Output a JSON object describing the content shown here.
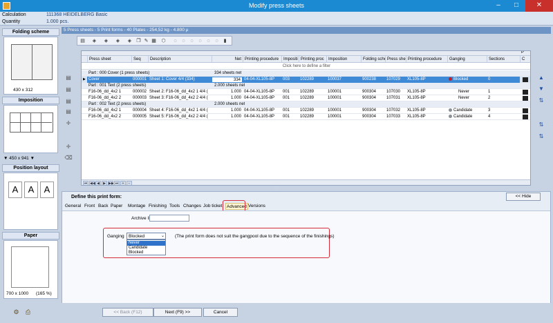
{
  "window": {
    "title": "Modify press sheets",
    "minimize": "–",
    "maximize": "□",
    "close": "✕"
  },
  "header": {
    "calculation_label": "Calculation",
    "calculation_value": "111368 HEIDELBERG Basic",
    "quantity_label": "Quantity",
    "quantity_value": "1.000 pcs."
  },
  "left_panel": {
    "folding": {
      "title": "Folding scheme",
      "size": "430 x 312"
    },
    "imposition": {
      "title": "Imposition",
      "size": "450 x 941"
    },
    "position": {
      "title": "Position layout",
      "cells": [
        "A",
        "A",
        "A"
      ]
    },
    "paper": {
      "title": "Paper",
      "size": "700 x 1000",
      "percent": "(165 %)"
    }
  },
  "main": {
    "summary": "5 Press sheets - 5 Print forms - 40 Plates - 254,52 kg - 4.800 µ"
  },
  "grid": {
    "top_header_mark": "P",
    "columns": [
      "Press sheet",
      "Seq",
      "Description",
      "Net",
      "Printing procedure",
      "Impositi",
      "Printing proc",
      "Imposition",
      "Folding sche",
      "Press she",
      "Printing procedure",
      "Ganging",
      "Sections",
      "C"
    ],
    "filter_text": "Click here to define a filter",
    "groups": [
      {
        "label": "Part : 000 Cover (1 press sheets)",
        "total": "334 sheets net",
        "rows": [
          {
            "sheet": "Cover",
            "seq": "000001",
            "desc": "Sheet 1: Cover 4/4 (334)",
            "net": "334",
            "proc": "04-04-XL105-8P",
            "imp": "003",
            "pproc": "102289",
            "imposition": "100037",
            "fold": "900238",
            "press": "107029",
            "proc2": "XL105-8P",
            "ganging": "Blocked",
            "sections": "0"
          }
        ]
      },
      {
        "label": "Part : 001 Text (2 press sheets)",
        "total": "2.000 sheets net",
        "rows": [
          {
            "sheet": "F16-06_dd_4x2 1",
            "seq": "000002",
            "desc": "Sheet 2: F16-06_dd_4x2 1 4/4 (",
            "net": "1.000",
            "proc": "04-04-XL105-8P",
            "imp": "001",
            "pproc": "102289",
            "imposition": "100001",
            "fold": "900304",
            "press": "107030",
            "proc2": "XL105-8P",
            "ganging": "Never",
            "sections": "1"
          },
          {
            "sheet": "F16-06_dd_4x2 2",
            "seq": "000003",
            "desc": "Sheet 3: F16-06_dd_4x2 2 4/4 (",
            "net": "1.000",
            "proc": "04-04-XL105-8P",
            "imp": "001",
            "pproc": "102289",
            "imposition": "100001",
            "fold": "900304",
            "press": "107031",
            "proc2": "XL105-8P",
            "ganging": "Never",
            "sections": "2"
          }
        ]
      },
      {
        "label": "Part : 002 Text (2 press sheets)",
        "total": "2.000 sheets net",
        "rows": [
          {
            "sheet": "F16-06_dd_4x2 1",
            "seq": "000004",
            "desc": "Sheet 4: F16-06_dd_4x2 1 4/4 (",
            "net": "1.000",
            "proc": "04-04-XL105-8P",
            "imp": "001",
            "pproc": "102289",
            "imposition": "100001",
            "fold": "900304",
            "press": "107032",
            "proc2": "XL105-8P",
            "ganging": "Candidate",
            "sections": "3"
          },
          {
            "sheet": "F16-06_dd_4x2 2",
            "seq": "000005",
            "desc": "Sheet 5: F16-06_dd_4x2 2 4/4 (",
            "net": "1.000",
            "proc": "04-04-XL105-8P",
            "imp": "001",
            "pproc": "102289",
            "imposition": "100001",
            "fold": "900304",
            "press": "107033",
            "proc2": "XL105-8P",
            "ganging": "Candidate",
            "sections": "4"
          }
        ]
      }
    ],
    "nav": [
      "⏮",
      "◀◀",
      "◀",
      "▶",
      "▶▶",
      "⏭",
      "+",
      "−"
    ]
  },
  "define": {
    "title": "Define this print form:",
    "hide_label": "<< Hide",
    "tabs": [
      "General",
      "Front",
      "Back",
      "Paper",
      "Montage",
      "Finishing",
      "Tools",
      "Changes",
      "Job ticket",
      "Advanced",
      "Versions"
    ],
    "active_tab": "Advanced",
    "archive_label": "Archive ID",
    "ganging_label": "Ganging",
    "ganging_value": "Blocked",
    "ganging_options": [
      "Never",
      "Candidate",
      "Blocked"
    ],
    "ganging_note": "(The print form does not suit the gangpool due to the sequence of the finishings)"
  },
  "footer": {
    "back": "<< Back (F12)",
    "next": "Next (F9) >>",
    "cancel": "Cancel"
  },
  "colors": {
    "titlebar": "#1c8ad2",
    "highlight": "#3f8ad6",
    "annotation": "#d42a3a"
  }
}
